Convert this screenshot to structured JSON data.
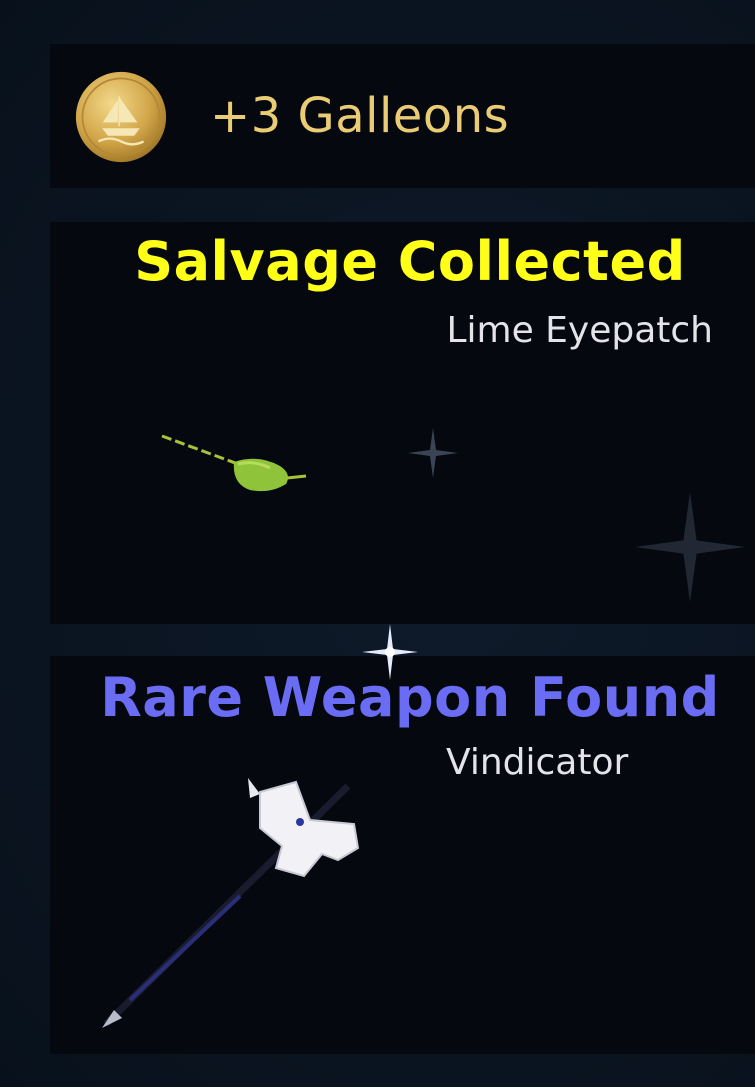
{
  "galleons": {
    "amount_label": "+3 Galleons",
    "icon": "gold-coin-ship-icon",
    "color": "#e9cc74"
  },
  "salvage": {
    "title": "Salvage Collected",
    "item_name": "Lime Eyepatch",
    "item_icon": "lime-eyepatch-icon",
    "title_color": "#ffff18"
  },
  "weapon": {
    "title": "Rare Weapon Found",
    "item_name": "Vindicator",
    "item_icon": "vindicator-halberd-icon",
    "title_color": "#6a6cf3"
  }
}
